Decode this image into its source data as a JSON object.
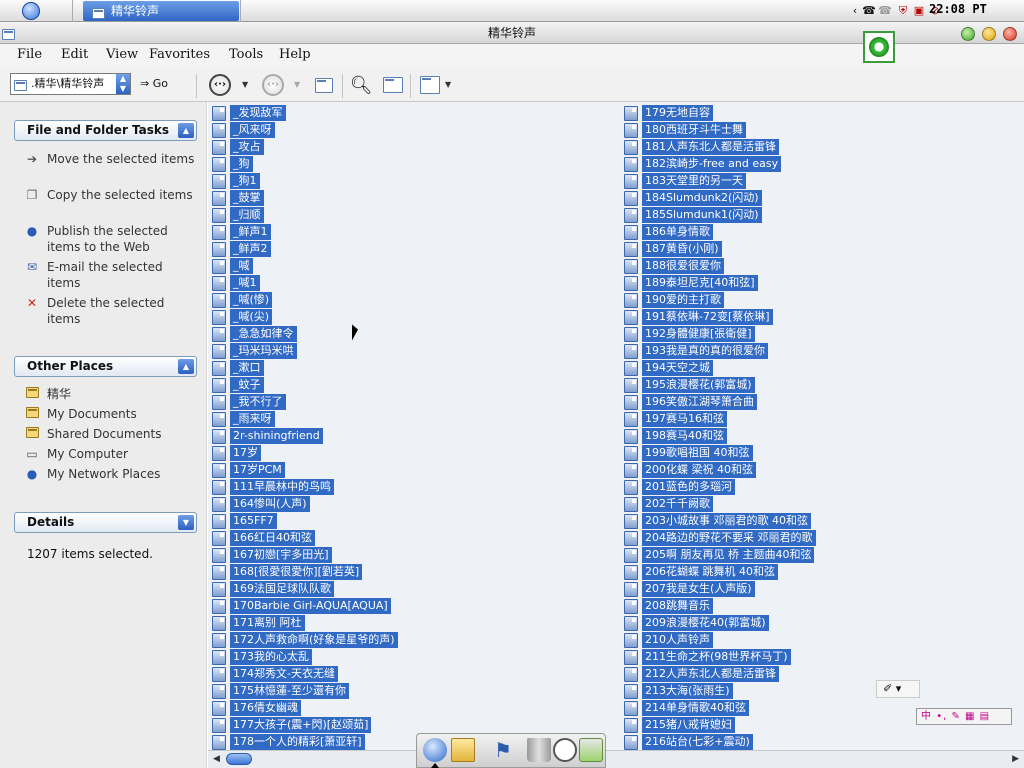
{
  "taskbar": {
    "task_title": "精华铃声",
    "clock": "22:08 PT"
  },
  "window": {
    "title": "精华铃声"
  },
  "menu": [
    "File",
    "Edit",
    "View",
    "Favorites",
    "Tools",
    "Help"
  ],
  "toolbar": {
    "address_value": ".精华\\精华铃声",
    "go_label": "Go"
  },
  "sidebar": {
    "tasks": {
      "title": "File and Folder Tasks",
      "items": [
        {
          "icon": "move-icon",
          "label": "Move the selected items"
        },
        {
          "icon": "copy-icon",
          "label": "Copy the selected items"
        },
        {
          "icon": "globe-icon",
          "label": "Publish the selected items to the Web"
        },
        {
          "icon": "email-icon",
          "label": "E-mail the selected items"
        },
        {
          "icon": "delete-icon",
          "label": "Delete the selected items"
        }
      ]
    },
    "other_places": {
      "title": "Other Places",
      "items": [
        {
          "icon": "folder-icon",
          "label": "精华"
        },
        {
          "icon": "documents-icon",
          "label": "My Documents"
        },
        {
          "icon": "shared-folder-icon",
          "label": "Shared Documents"
        },
        {
          "icon": "computer-icon",
          "label": "My Computer"
        },
        {
          "icon": "network-icon",
          "label": "My Network Places"
        }
      ]
    },
    "details": {
      "title": "Details",
      "text": "1207 items selected."
    }
  },
  "files": {
    "left": [
      "_发现敌军",
      "_风来呀",
      "_攻占",
      "_狗",
      "_狗1",
      "_鼓掌",
      "_归顺",
      "_鲜声1",
      "_鲜声2",
      "_喊",
      "_喊1",
      "_喊(惨)",
      "_喊(尖)",
      "_急急如律令",
      "_玛米玛米哄",
      "_漱口",
      "_蚊子",
      "_我不行了",
      "_雨来呀",
      "2r-shiningfriend",
      "17岁",
      "17岁PCM",
      "111早晨林中的鸟鸣",
      "164惨叫(人声)",
      "165FF7",
      "166红日40和弦",
      "167初戀[宇多田光]",
      "168[很愛很愛你][劉若英]",
      "169法国足球队队歌",
      "170Barbie Girl-AQUA[AQUA]",
      "171离别 阿杜",
      "172人声救命啊(好象是星爷的声)",
      "173我的心太乱",
      "174郑秀文-天衣无缝",
      "175林憶蓮-至少還有你",
      "176倩女幽魂",
      "177大孩子(震+閃)[赵颂茹]",
      "178一个人的精彩[萧亚轩]"
    ],
    "right": [
      "179无地自容",
      "180西班牙斗牛士舞",
      "181人声东北人都是活雷锋",
      "182滨崎步-free and easy",
      "183天堂里的另一天",
      "184Slumdunk2(闪动)",
      "185Slumdunk1(闪动)",
      "186单身情歌",
      "187黄昏(小刚)",
      "188很爱很爱你",
      "189泰坦尼克[40和弦]",
      "190爱的主打歌",
      "191蔡依琳-72变[蔡依琳]",
      "192身體健康[張衛健]",
      "193我是真的真的很爱你",
      "194天空之城",
      "195浪漫樱花(郭富城)",
      "196笑傲江湖琴箫合曲",
      "197赛马16和弦",
      "198赛马40和弦",
      "199歌唱祖国 40和弦",
      "200化蝶 梁祝 40和弦",
      "201蓝色的多瑙河",
      "202千千阙歌",
      "203小城故事 邓丽君的歌 40和弦",
      "204路边的野花不要采 邓丽君的歌",
      "205啊 朋友再见 桥 主题曲40和弦",
      "206花蝴蝶 跳舞机 40和弦",
      "207我是女生(人声版)",
      "208跳舞音乐",
      "209浪漫樱花40(郭富城)",
      "210人声铃声",
      "211生命之杯(98世界杯马丁)",
      "212人声东北人都是活雷锋",
      "213大海(张雨生)",
      "214单身情歌40和弦",
      "215猪八戒背媳妇",
      "216站台(七彩+震动)"
    ]
  },
  "colors": {
    "selection": "#316ac5",
    "content_bg": "#eef2f6",
    "sidebar_bg": "#ececec"
  }
}
